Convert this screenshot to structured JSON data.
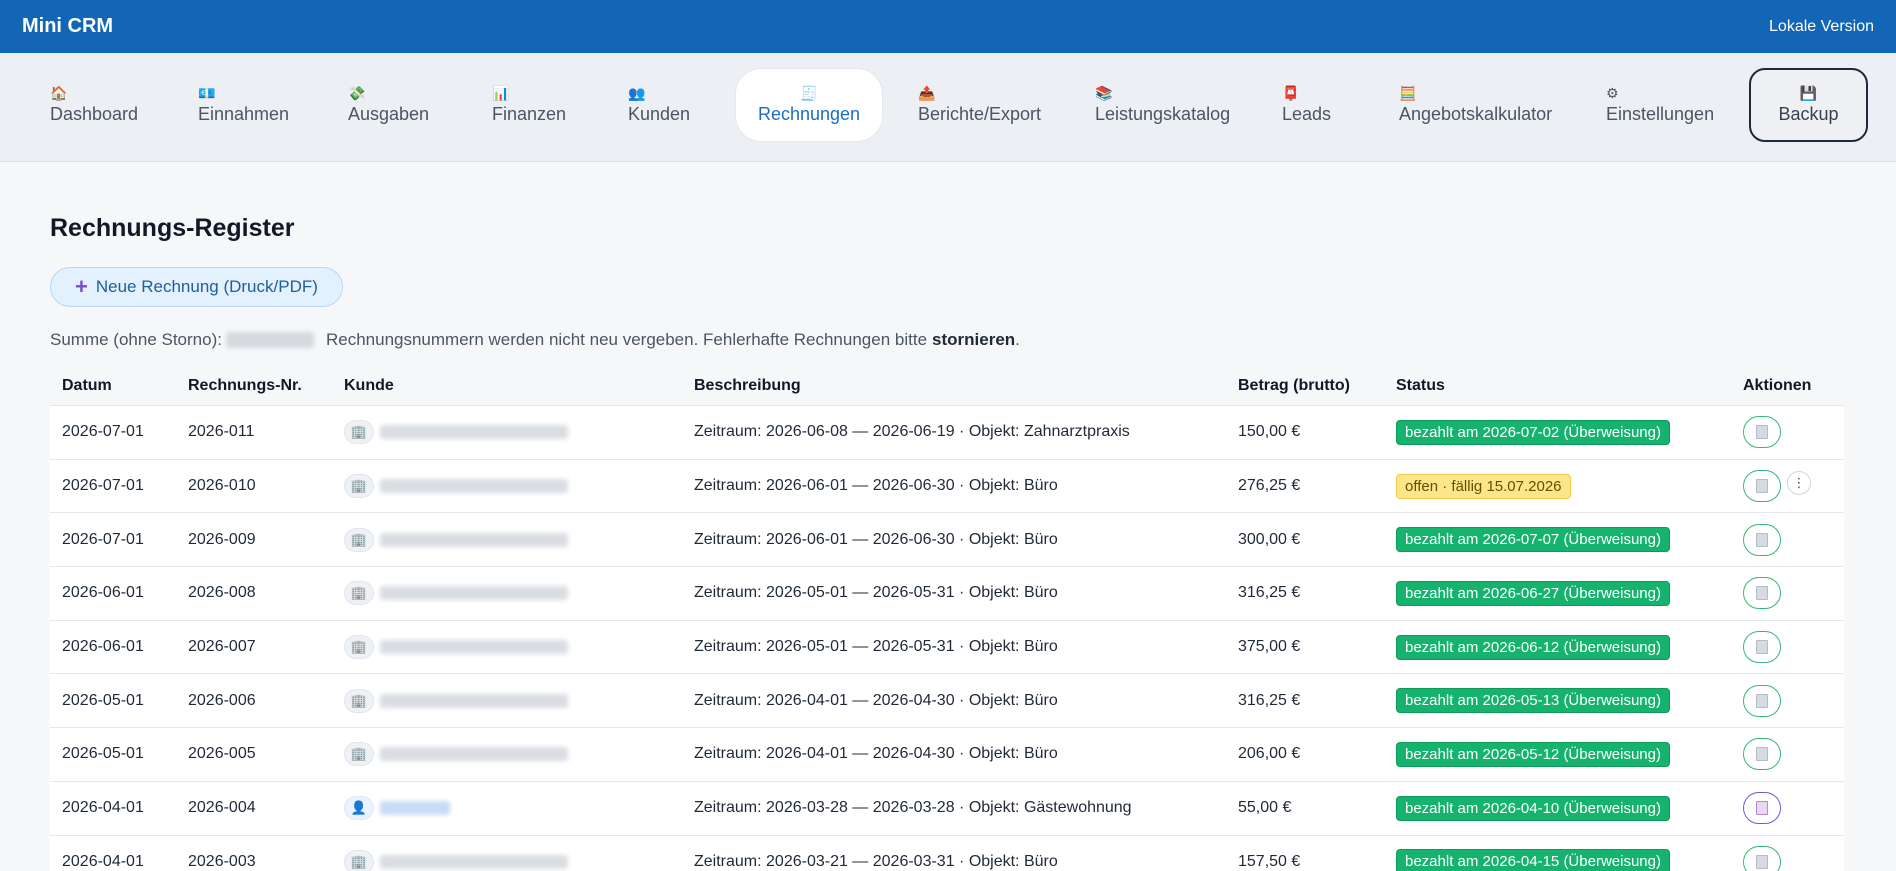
{
  "app": {
    "title": "Mini CRM",
    "version": "Lokale Version"
  },
  "nav": [
    {
      "icon": "🏠",
      "label": "Dashboard"
    },
    {
      "icon": "💶",
      "label": "Einnahmen"
    },
    {
      "icon": "💸",
      "label": "Ausgaben"
    },
    {
      "icon": "📊",
      "label": "Finanzen"
    },
    {
      "icon": "👥",
      "label": "Kunden"
    },
    {
      "icon": "🧾",
      "label": "Rechnungen"
    },
    {
      "icon": "📤",
      "label": "Berichte/Export"
    },
    {
      "icon": "📚",
      "label": "Leistungskatalog"
    },
    {
      "icon": "📮",
      "label": "Leads"
    },
    {
      "icon": "🧮",
      "label": "Angebotskalkulator"
    },
    {
      "icon": "⚙",
      "label": "Einstellungen"
    },
    {
      "icon": "💾",
      "label": "Backup"
    }
  ],
  "active_nav": "Rechnungen",
  "page": {
    "title": "Rechnungs-Register",
    "new_button": "Neue Rechnung (Druck/PDF)",
    "summary_label": "Summe (ohne Storno):",
    "summary_note": "Rechnungsnummern werden nicht neu vergeben. Fehlerhafte Rechnungen bitte",
    "summary_strong": "stornieren",
    "summary_end": "."
  },
  "table": {
    "headers": [
      "Datum",
      "Rechnungs-Nr.",
      "Kunde",
      "Beschreibung",
      "Betrag (brutto)",
      "Status",
      "Aktionen"
    ],
    "rows": [
      {
        "datum": "2026-07-01",
        "nr": "2026-011",
        "kunde_type": "company",
        "beschreibung": "Zeitraum: 2026-06-08 — 2026-06-19 · Objekt: Zahnarztpraxis",
        "betrag": "150,00 €",
        "status": "bezahlt am 2026-07-02 (Überweisung)",
        "status_type": "paid"
      },
      {
        "datum": "2026-07-01",
        "nr": "2026-010",
        "kunde_type": "company",
        "beschreibung": "Zeitraum: 2026-06-01 — 2026-06-30 · Objekt: Büro",
        "betrag": "276,25 €",
        "status": "offen · fällig 15.07.2026",
        "status_type": "open"
      },
      {
        "datum": "2026-07-01",
        "nr": "2026-009",
        "kunde_type": "company",
        "beschreibung": "Zeitraum: 2026-06-01 — 2026-06-30 · Objekt: Büro",
        "betrag": "300,00 €",
        "status": "bezahlt am 2026-07-07 (Überweisung)",
        "status_type": "paid"
      },
      {
        "datum": "2026-06-01",
        "nr": "2026-008",
        "kunde_type": "company",
        "beschreibung": "Zeitraum: 2026-05-01 — 2026-05-31 · Objekt: Büro",
        "betrag": "316,25 €",
        "status": "bezahlt am 2026-06-27 (Überweisung)",
        "status_type": "paid"
      },
      {
        "datum": "2026-06-01",
        "nr": "2026-007",
        "kunde_type": "company",
        "beschreibung": "Zeitraum: 2026-05-01 — 2026-05-31 · Objekt: Büro",
        "betrag": "375,00 €",
        "status": "bezahlt am 2026-06-12 (Überweisung)",
        "status_type": "paid"
      },
      {
        "datum": "2026-05-01",
        "nr": "2026-006",
        "kunde_type": "company",
        "beschreibung": "Zeitraum: 2026-04-01 — 2026-04-30 · Objekt: Büro",
        "betrag": "316,25 €",
        "status": "bezahlt am 2026-05-13 (Überweisung)",
        "status_type": "paid"
      },
      {
        "datum": "2026-05-01",
        "nr": "2026-005",
        "kunde_type": "company",
        "beschreibung": "Zeitraum: 2026-04-01 — 2026-04-30 · Objekt: Büro",
        "betrag": "206,00 €",
        "status": "bezahlt am 2026-05-12 (Überweisung)",
        "status_type": "paid"
      },
      {
        "datum": "2026-04-01",
        "nr": "2026-004",
        "kunde_type": "person",
        "beschreibung": "Zeitraum: 2026-03-28 — 2026-03-28 · Objekt: Gästewohnung",
        "betrag": "55,00 €",
        "status": "bezahlt am 2026-04-10 (Überweisung)",
        "status_type": "paid"
      },
      {
        "datum": "2026-04-01",
        "nr": "2026-003",
        "kunde_type": "company",
        "beschreibung": "Zeitraum: 2026-03-21 — 2026-03-31 · Objekt: Büro",
        "betrag": "157,50 €",
        "status": "bezahlt am 2026-04-15 (Überweisung)",
        "status_type": "paid"
      }
    ]
  },
  "colors": {
    "topbar": "#1266b5",
    "accent": "#1a6fc2",
    "paid": "#16b36e",
    "open": "#fde68a"
  },
  "icons": {
    "company": "building-icon",
    "person": "person-icon",
    "document": "document-icon",
    "more": "more-vertical-icon"
  }
}
